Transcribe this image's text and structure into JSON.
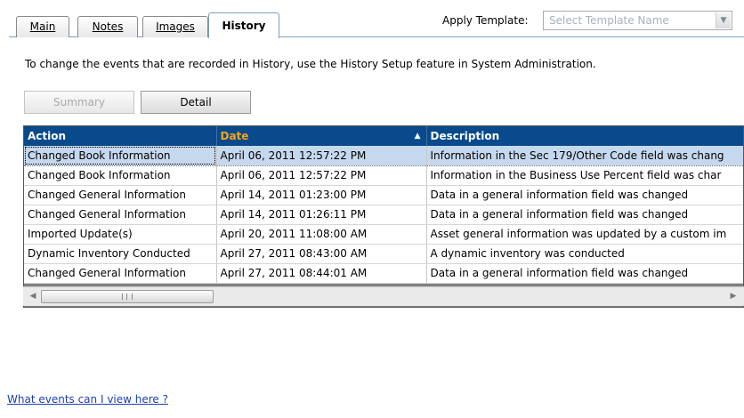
{
  "tabs": [
    {
      "label": "Main",
      "active": false
    },
    {
      "label": "Notes",
      "active": false
    },
    {
      "label": "Images",
      "active": false
    },
    {
      "label": "History",
      "active": true
    }
  ],
  "template": {
    "label": "Apply Template:",
    "placeholder": "Select Template Name"
  },
  "info_text": "To change the events that are recorded in History, use the History Setup feature in System Administration.",
  "buttons": {
    "summary": "Summary",
    "detail": "Detail"
  },
  "grid": {
    "columns": [
      "Action",
      "Date",
      "Description"
    ],
    "sorted_column": "Date",
    "rows": [
      {
        "action": "Changed Book Information",
        "date": "April 06, 2011  12:57:22 PM",
        "description": "Information in the Sec 179/Other Code field was chang",
        "selected": true
      },
      {
        "action": "Changed Book Information",
        "date": "April 06, 2011  12:57:22 PM",
        "description": "Information in the Business Use Percent field was char"
      },
      {
        "action": "Changed General Information",
        "date": "April 14, 2011  01:23:00 PM",
        "description": "Data in a general information field was changed"
      },
      {
        "action": "Changed General Information",
        "date": "April 14, 2011  01:26:11 PM",
        "description": "Data in a general information field was changed"
      },
      {
        "action": "Imported Update(s)",
        "date": "April 20, 2011  11:08:00 AM",
        "description": "Asset general information was updated by a custom im"
      },
      {
        "action": "Dynamic Inventory Conducted",
        "date": "April 27, 2011  08:43:00 AM",
        "description": "A dynamic inventory was conducted"
      },
      {
        "action": "Changed General Information",
        "date": "April 27, 2011  08:44:01 AM",
        "description": "Data in a general information field was changed"
      }
    ]
  },
  "help_link": "What events can I view here ?",
  "colors": {
    "header_bg": "#084a8c",
    "sorted_header_text": "#f5a51c",
    "selected_row": "#c6d8ee",
    "link": "#1a3fb5"
  }
}
